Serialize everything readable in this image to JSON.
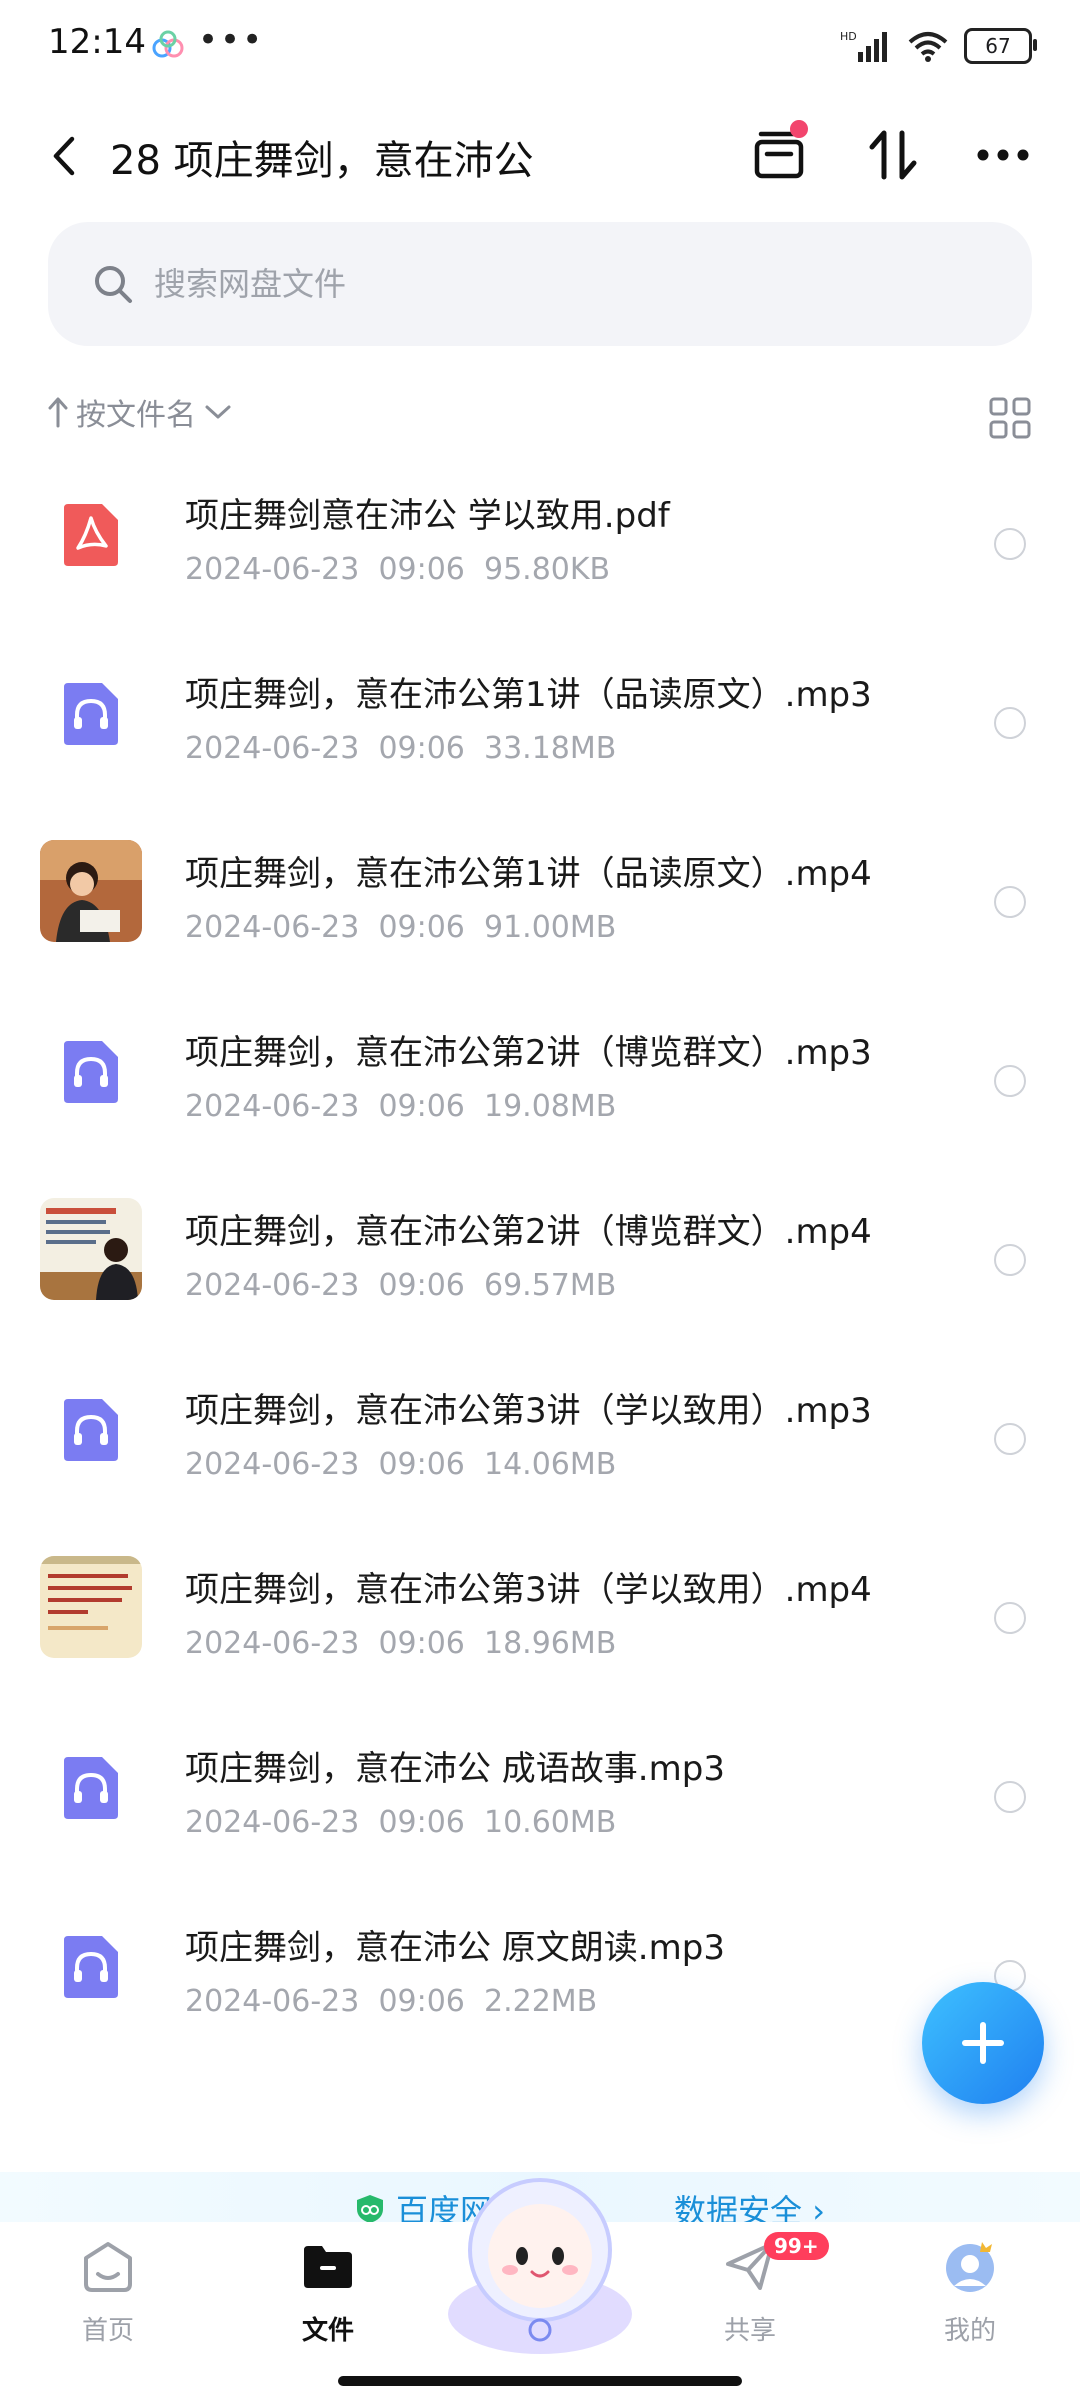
{
  "status": {
    "time": "12:14",
    "network": "HD",
    "battery": "67"
  },
  "header": {
    "title": "28 项庄舞剑，意在沛公"
  },
  "search": {
    "placeholder": "搜索网盘文件"
  },
  "sort": {
    "label": "按文件名"
  },
  "files": [
    {
      "name": "项庄舞剑意在沛公 学以致用.pdf",
      "date": "2024-06-23",
      "time": "09:06",
      "size": "95.80KB",
      "type": "pdf-icon"
    },
    {
      "name": "项庄舞剑，意在沛公第1讲（品读原文）.mp3",
      "date": "2024-06-23",
      "time": "09:06",
      "size": "33.18MB",
      "type": "audio-file-icon"
    },
    {
      "name": "项庄舞剑，意在沛公第1讲（品读原文）.mp4",
      "date": "2024-06-23",
      "time": "09:06",
      "size": "91.00MB",
      "type": "video-thumbnail"
    },
    {
      "name": "项庄舞剑，意在沛公第2讲（博览群文）.mp3",
      "date": "2024-06-23",
      "time": "09:06",
      "size": "19.08MB",
      "type": "audio-file-icon"
    },
    {
      "name": "项庄舞剑，意在沛公第2讲（博览群文）.mp4",
      "date": "2024-06-23",
      "time": "09:06",
      "size": "69.57MB",
      "type": "video-thumbnail"
    },
    {
      "name": "项庄舞剑，意在沛公第3讲（学以致用）.mp3",
      "date": "2024-06-23",
      "time": "09:06",
      "size": "14.06MB",
      "type": "audio-file-icon"
    },
    {
      "name": "项庄舞剑，意在沛公第3讲（学以致用）.mp4",
      "date": "2024-06-23",
      "time": "09:06",
      "size": "18.96MB",
      "type": "video-thumbnail"
    },
    {
      "name": "项庄舞剑，意在沛公 成语故事.mp3",
      "date": "2024-06-23",
      "time": "09:06",
      "size": "10.60MB",
      "type": "audio-file-icon"
    },
    {
      "name": "项庄舞剑，意在沛公 原文朗读.mp3",
      "date": "2024-06-23",
      "time": "09:06",
      "size": "2.22MB",
      "type": "audio-file-icon"
    }
  ],
  "banner": {
    "text": "百度网盘",
    "text_tail": "数据安全 ›"
  },
  "tabbar": {
    "home": "首页",
    "files": "文件",
    "share": "共享",
    "share_badge": "99+",
    "mine": "我的"
  },
  "colors": {
    "accent": "#1f7ff0",
    "audio_icon": "#7b7cf2",
    "pdf_icon": "#f05a5a",
    "badge": "#ff3e5c"
  }
}
